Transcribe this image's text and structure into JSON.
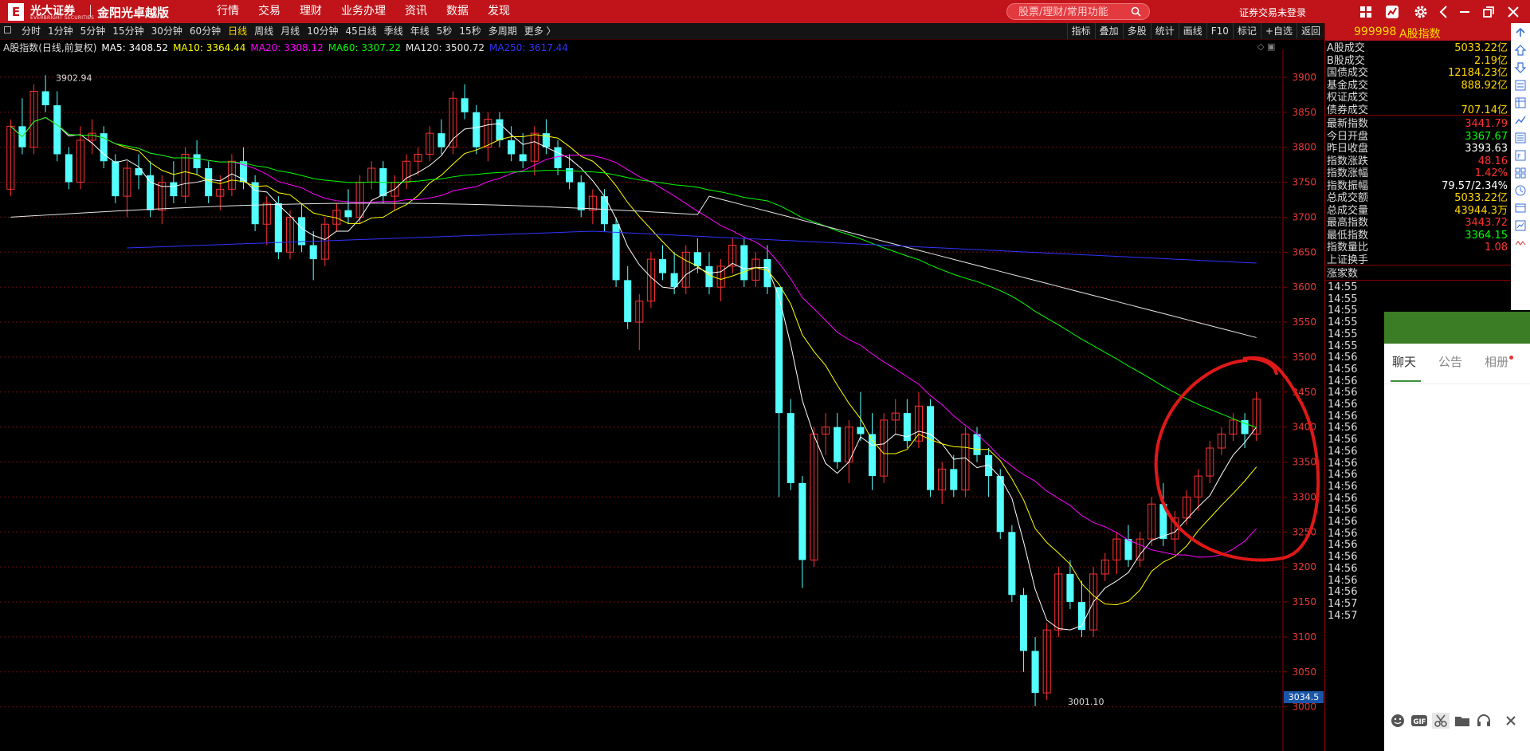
{
  "app": {
    "logo_letter": "E",
    "brand": "光大证券",
    "brand_en": "EVERBRIGHT SECURITIES",
    "product": "金阳光卓越版",
    "menu": [
      "行情",
      "交易",
      "理财",
      "业务办理",
      "资讯",
      "数据",
      "发现"
    ],
    "search_placeholder": "股票/理财/常用功能",
    "login_status": "证券交易未登录"
  },
  "periods": {
    "items": [
      "分时",
      "1分钟",
      "5分钟",
      "15分钟",
      "30分钟",
      "60分钟",
      "日线",
      "周线",
      "月线",
      "10分钟",
      "45日线",
      "季线",
      "年线",
      "5秒",
      "15秒",
      "多周期",
      "更多 〉"
    ],
    "active": "日线"
  },
  "tools": [
    "指标",
    "叠加",
    "多股",
    "统计",
    "画线",
    "F10",
    "标记",
    "+自选",
    "返回"
  ],
  "legend": {
    "name": "A股指数(日线,前复权)",
    "ma5": "MA5: 3408.52",
    "ma10": "MA10: 3364.44",
    "ma20": "MA20: 3308.12",
    "ma60": "MA60: 3307.22",
    "ma120": "MA120: 3500.72",
    "ma250": "MA250: 3617.44"
  },
  "chart_data": {
    "type": "candlestick",
    "ylim": [
      2970,
      3925
    ],
    "y_ticks": [
      3900,
      3850,
      3800,
      3750,
      3700,
      3650,
      3600,
      3550,
      3500,
      3450,
      3400,
      3350,
      3300,
      3250,
      3200,
      3150,
      3100,
      3050,
      3000
    ],
    "annotations": {
      "high_label": "3902.94",
      "low_label": "3001.10",
      "current_price": "3034.5"
    },
    "colors": {
      "up": "#ff3232",
      "down": "#54ffff",
      "ma5": "#ffffff",
      "ma10": "#ffff00",
      "ma20": "#ff00ff",
      "ma60": "#00ff00",
      "ma120": "#e6e6e6",
      "ma250": "#3333ff"
    },
    "ohlc": [
      [
        3740,
        3840,
        3730,
        3830
      ],
      [
        3830,
        3870,
        3790,
        3800
      ],
      [
        3800,
        3890,
        3790,
        3880
      ],
      [
        3880,
        3903,
        3850,
        3860
      ],
      [
        3860,
        3880,
        3780,
        3790
      ],
      [
        3790,
        3800,
        3740,
        3750
      ],
      [
        3750,
        3830,
        3740,
        3810
      ],
      [
        3810,
        3840,
        3790,
        3820
      ],
      [
        3820,
        3830,
        3770,
        3780
      ],
      [
        3780,
        3790,
        3720,
        3730
      ],
      [
        3730,
        3780,
        3700,
        3770
      ],
      [
        3770,
        3790,
        3740,
        3760
      ],
      [
        3760,
        3780,
        3700,
        3710
      ],
      [
        3710,
        3760,
        3690,
        3750
      ],
      [
        3750,
        3780,
        3720,
        3730
      ],
      [
        3730,
        3800,
        3720,
        3790
      ],
      [
        3790,
        3810,
        3760,
        3770
      ],
      [
        3770,
        3780,
        3720,
        3730
      ],
      [
        3730,
        3760,
        3710,
        3740
      ],
      [
        3740,
        3790,
        3730,
        3780
      ],
      [
        3780,
        3800,
        3740,
        3750
      ],
      [
        3750,
        3760,
        3680,
        3690
      ],
      [
        3690,
        3730,
        3660,
        3720
      ],
      [
        3720,
        3730,
        3640,
        3650
      ],
      [
        3650,
        3710,
        3640,
        3700
      ],
      [
        3700,
        3720,
        3650,
        3660
      ],
      [
        3660,
        3680,
        3610,
        3640
      ],
      [
        3640,
        3700,
        3630,
        3690
      ],
      [
        3690,
        3720,
        3680,
        3710
      ],
      [
        3710,
        3740,
        3690,
        3700
      ],
      [
        3700,
        3760,
        3690,
        3750
      ],
      [
        3750,
        3780,
        3740,
        3770
      ],
      [
        3770,
        3780,
        3720,
        3730
      ],
      [
        3730,
        3760,
        3710,
        3750
      ],
      [
        3750,
        3790,
        3740,
        3780
      ],
      [
        3780,
        3800,
        3760,
        3790
      ],
      [
        3790,
        3830,
        3780,
        3820
      ],
      [
        3820,
        3840,
        3790,
        3800
      ],
      [
        3800,
        3880,
        3790,
        3870
      ],
      [
        3870,
        3890,
        3840,
        3850
      ],
      [
        3850,
        3860,
        3790,
        3800
      ],
      [
        3800,
        3850,
        3780,
        3840
      ],
      [
        3840,
        3850,
        3800,
        3810
      ],
      [
        3810,
        3830,
        3780,
        3790
      ],
      [
        3790,
        3820,
        3770,
        3780
      ],
      [
        3780,
        3830,
        3760,
        3820
      ],
      [
        3820,
        3840,
        3790,
        3800
      ],
      [
        3800,
        3810,
        3760,
        3770
      ],
      [
        3770,
        3790,
        3740,
        3750
      ],
      [
        3750,
        3760,
        3700,
        3710
      ],
      [
        3710,
        3740,
        3690,
        3730
      ],
      [
        3730,
        3740,
        3680,
        3690
      ],
      [
        3690,
        3700,
        3600,
        3610
      ],
      [
        3610,
        3630,
        3540,
        3550
      ],
      [
        3550,
        3590,
        3510,
        3580
      ],
      [
        3580,
        3650,
        3570,
        3640
      ],
      [
        3640,
        3660,
        3610,
        3620
      ],
      [
        3620,
        3650,
        3590,
        3600
      ],
      [
        3600,
        3660,
        3590,
        3650
      ],
      [
        3650,
        3670,
        3620,
        3630
      ],
      [
        3630,
        3650,
        3590,
        3600
      ],
      [
        3600,
        3640,
        3580,
        3630
      ],
      [
        3630,
        3670,
        3620,
        3660
      ],
      [
        3660,
        3670,
        3600,
        3610
      ],
      [
        3610,
        3650,
        3600,
        3640
      ],
      [
        3640,
        3660,
        3590,
        3600
      ],
      [
        3600,
        3480,
        3300,
        3420
      ],
      [
        3420,
        3440,
        3310,
        3320
      ],
      [
        3320,
        3330,
        3170,
        3210
      ],
      [
        3210,
        3400,
        3200,
        3390
      ],
      [
        3390,
        3420,
        3360,
        3400
      ],
      [
        3400,
        3420,
        3340,
        3350
      ],
      [
        3350,
        3410,
        3320,
        3400
      ],
      [
        3400,
        3450,
        3380,
        3390
      ],
      [
        3390,
        3420,
        3310,
        3330
      ],
      [
        3330,
        3420,
        3320,
        3410
      ],
      [
        3410,
        3440,
        3390,
        3420
      ],
      [
        3420,
        3440,
        3370,
        3380
      ],
      [
        3380,
        3450,
        3370,
        3430
      ],
      [
        3430,
        3440,
        3300,
        3310
      ],
      [
        3310,
        3350,
        3290,
        3340
      ],
      [
        3340,
        3360,
        3300,
        3310
      ],
      [
        3310,
        3400,
        3300,
        3390
      ],
      [
        3390,
        3400,
        3350,
        3360
      ],
      [
        3360,
        3370,
        3300,
        3330
      ],
      [
        3330,
        3340,
        3240,
        3250
      ],
      [
        3250,
        3260,
        3150,
        3160
      ],
      [
        3160,
        3170,
        3050,
        3080
      ],
      [
        3080,
        3100,
        3001,
        3020
      ],
      [
        3020,
        3120,
        3010,
        3110
      ],
      [
        3110,
        3200,
        3100,
        3190
      ],
      [
        3190,
        3210,
        3140,
        3150
      ],
      [
        3150,
        3180,
        3100,
        3110
      ],
      [
        3110,
        3200,
        3100,
        3190
      ],
      [
        3190,
        3220,
        3180,
        3210
      ],
      [
        3210,
        3250,
        3190,
        3240
      ],
      [
        3240,
        3260,
        3200,
        3210
      ],
      [
        3210,
        3250,
        3200,
        3240
      ],
      [
        3240,
        3300,
        3230,
        3290
      ],
      [
        3290,
        3320,
        3230,
        3240
      ],
      [
        3240,
        3280,
        3220,
        3270
      ],
      [
        3270,
        3310,
        3260,
        3300
      ],
      [
        3300,
        3340,
        3280,
        3330
      ],
      [
        3330,
        3380,
        3320,
        3370
      ],
      [
        3370,
        3400,
        3360,
        3390
      ],
      [
        3390,
        3420,
        3380,
        3410
      ],
      [
        3410,
        3420,
        3370,
        3390
      ],
      [
        3390,
        3450,
        3380,
        3440
      ]
    ]
  },
  "quote": {
    "code": "999998",
    "name": "A股指数",
    "rows1": [
      {
        "label": "A股成交",
        "value": "5033.22亿",
        "color": "#ffd700"
      },
      {
        "label": "B股成交",
        "value": "2.19亿",
        "color": "#ffd700"
      },
      {
        "label": "国债成交",
        "value": "12184.23亿",
        "color": "#ffd700"
      },
      {
        "label": "基金成交",
        "value": "888.92亿",
        "color": "#ffd700"
      },
      {
        "label": "权证成交",
        "value": "",
        "color": "#ffd700"
      },
      {
        "label": "债券成交",
        "value": "707.14亿",
        "color": "#ffd700"
      }
    ],
    "rows2": [
      {
        "label": "最新指数",
        "value": "3441.79",
        "color": "#ff3232"
      },
      {
        "label": "今日开盘",
        "value": "3367.67",
        "color": "#00ff00"
      },
      {
        "label": "昨日收盘",
        "value": "3393.63",
        "color": "#ffffff"
      },
      {
        "label": "指数涨跌",
        "value": "48.16",
        "color": "#ff3232"
      },
      {
        "label": "指数涨幅",
        "value": "1.42%",
        "color": "#ff3232"
      },
      {
        "label": "指数振幅",
        "value": "79.57/2.34%",
        "color": "#ffffff"
      },
      {
        "label": "总成交额",
        "value": "5033.22亿",
        "color": "#ffd700"
      },
      {
        "label": "总成交量",
        "value": "43944.3万",
        "color": "#ffd700"
      },
      {
        "label": "最高指数",
        "value": "3443.72",
        "color": "#ff3232"
      },
      {
        "label": "最低指数",
        "value": "3364.15",
        "color": "#00ff00"
      },
      {
        "label": "指数量比",
        "value": "1.08",
        "color": "#ff3232"
      },
      {
        "label": "上证换手",
        "value": "",
        "color": "#ffd700"
      }
    ],
    "section_label": "涨家数",
    "ticks": [
      "14:55",
      "14:55",
      "14:55",
      "14:55",
      "14:55",
      "14:55",
      "14:56",
      "14:56",
      "14:56",
      "14:56",
      "14:56",
      "14:56",
      "14:56",
      "14:56",
      "14:56",
      "14:56",
      "14:56",
      "14:56",
      "14:56",
      "14:56",
      "14:56",
      "14:56",
      "14:56",
      "14:56",
      "14:56",
      "14:56",
      "14:56",
      "14:57",
      "14:57"
    ]
  },
  "chat": {
    "tabs": [
      "聊天",
      "公告",
      "相册"
    ],
    "active": "聊天"
  }
}
